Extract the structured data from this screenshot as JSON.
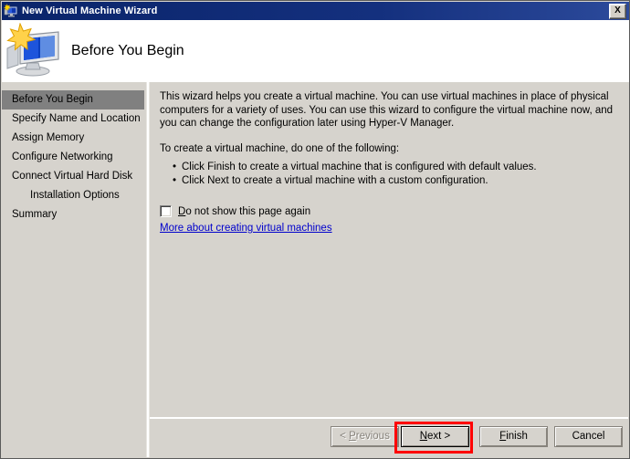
{
  "window": {
    "title": "New Virtual Machine Wizard",
    "title_icon": "vm-monitor-icon",
    "close_label": "X"
  },
  "header": {
    "title": "Before You Begin",
    "icon": "vm-monitor-star-icon"
  },
  "sidebar": {
    "items": [
      {
        "label": "Before You Begin",
        "selected": true,
        "indent": false
      },
      {
        "label": "Specify Name and Location",
        "selected": false,
        "indent": false
      },
      {
        "label": "Assign Memory",
        "selected": false,
        "indent": false
      },
      {
        "label": "Configure Networking",
        "selected": false,
        "indent": false
      },
      {
        "label": "Connect Virtual Hard Disk",
        "selected": false,
        "indent": false
      },
      {
        "label": "Installation Options",
        "selected": false,
        "indent": true
      },
      {
        "label": "Summary",
        "selected": false,
        "indent": false
      }
    ]
  },
  "content": {
    "paragraph1": "This wizard helps you create a virtual machine. You can use virtual machines in place of physical computers for a variety of uses. You can use this wizard to configure the virtual machine now, and you can change the configuration later using Hyper-V Manager.",
    "paragraph2": "To create a virtual machine, do one of the following:",
    "bullets": [
      "Click Finish to create a virtual machine that is configured with default values.",
      "Click Next to create a virtual machine with a custom configuration."
    ],
    "checkbox": {
      "label_accel": "D",
      "label_rest": "o not show this page again",
      "checked": false
    },
    "link": "More about creating virtual machines"
  },
  "footer": {
    "buttons": [
      {
        "id": "previous",
        "prefix": "< ",
        "accel": "P",
        "rest": "revious",
        "suffix": "",
        "disabled": true,
        "default": false
      },
      {
        "id": "next",
        "prefix": "",
        "accel": "N",
        "rest": "ext",
        "suffix": " >",
        "disabled": false,
        "default": true
      },
      {
        "id": "finish",
        "prefix": "",
        "accel": "F",
        "rest": "inish",
        "suffix": "",
        "disabled": false,
        "default": false
      },
      {
        "id": "cancel",
        "prefix": "",
        "accel": "",
        "rest": "Cancel",
        "suffix": "",
        "disabled": false,
        "default": false
      }
    ]
  },
  "annotation": {
    "target": "next-button",
    "color": "#ff0000"
  },
  "colors": {
    "titlebar_start": "#0a246a",
    "titlebar_end": "#2c4a9b",
    "face": "#d6d3cd",
    "selection": "#808080",
    "link": "#0000cc",
    "annotation": "#ff0000"
  }
}
